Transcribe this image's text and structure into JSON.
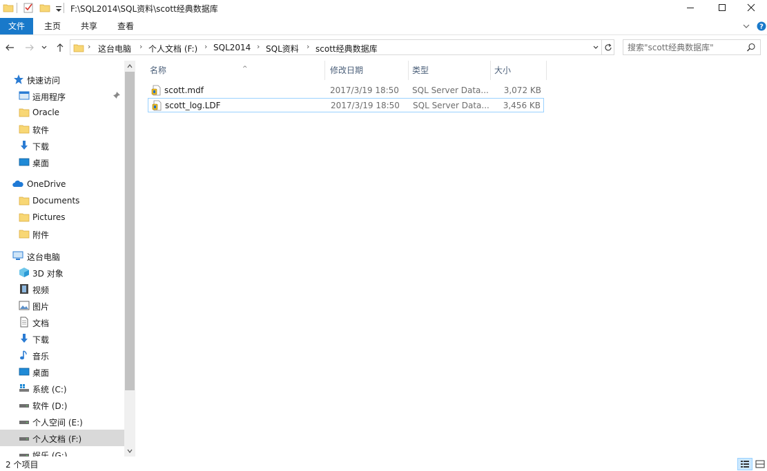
{
  "window": {
    "title": "F:\\SQL2014\\SQL资料\\scott经典数据库"
  },
  "ribbon": {
    "tabs": [
      {
        "label": "文件"
      },
      {
        "label": "主页"
      },
      {
        "label": "共享"
      },
      {
        "label": "查看"
      }
    ],
    "accent": "#1979ca"
  },
  "address": {
    "crumbs": [
      "这台电脑",
      "个人文档 (F:)",
      "SQL2014",
      "SQL资料",
      "scott经典数据库"
    ]
  },
  "search": {
    "placeholder": "搜索\"scott经典数据库\""
  },
  "nav": {
    "quick_access": "快速访问",
    "quick_items": [
      "运用程序",
      "Oracle",
      "软件",
      "下载",
      "桌面"
    ],
    "onedrive": "OneDrive",
    "onedrive_items": [
      "Documents",
      "Pictures",
      "附件"
    ],
    "this_pc": "这台电脑",
    "pc_items": [
      "3D 对象",
      "视频",
      "图片",
      "文档",
      "下载",
      "音乐",
      "桌面"
    ],
    "drives": [
      "系统 (C:)",
      "软件 (D:)",
      "个人空间 (E:)",
      "个人文档 (F:)",
      "娱乐 (G:)"
    ],
    "selected": "个人文档 (F:)"
  },
  "columns": {
    "name": "名称",
    "date": "修改日期",
    "type": "类型",
    "size": "大小"
  },
  "files": [
    {
      "name": "scott.mdf",
      "date": "2017/3/19 18:50",
      "type": "SQL Server Data...",
      "size": "3,072 KB"
    },
    {
      "name": "scott_log.LDF",
      "date": "2017/3/19 18:50",
      "type": "SQL Server Data...",
      "size": "3,456 KB"
    }
  ],
  "status": {
    "count": "2 个项目"
  }
}
